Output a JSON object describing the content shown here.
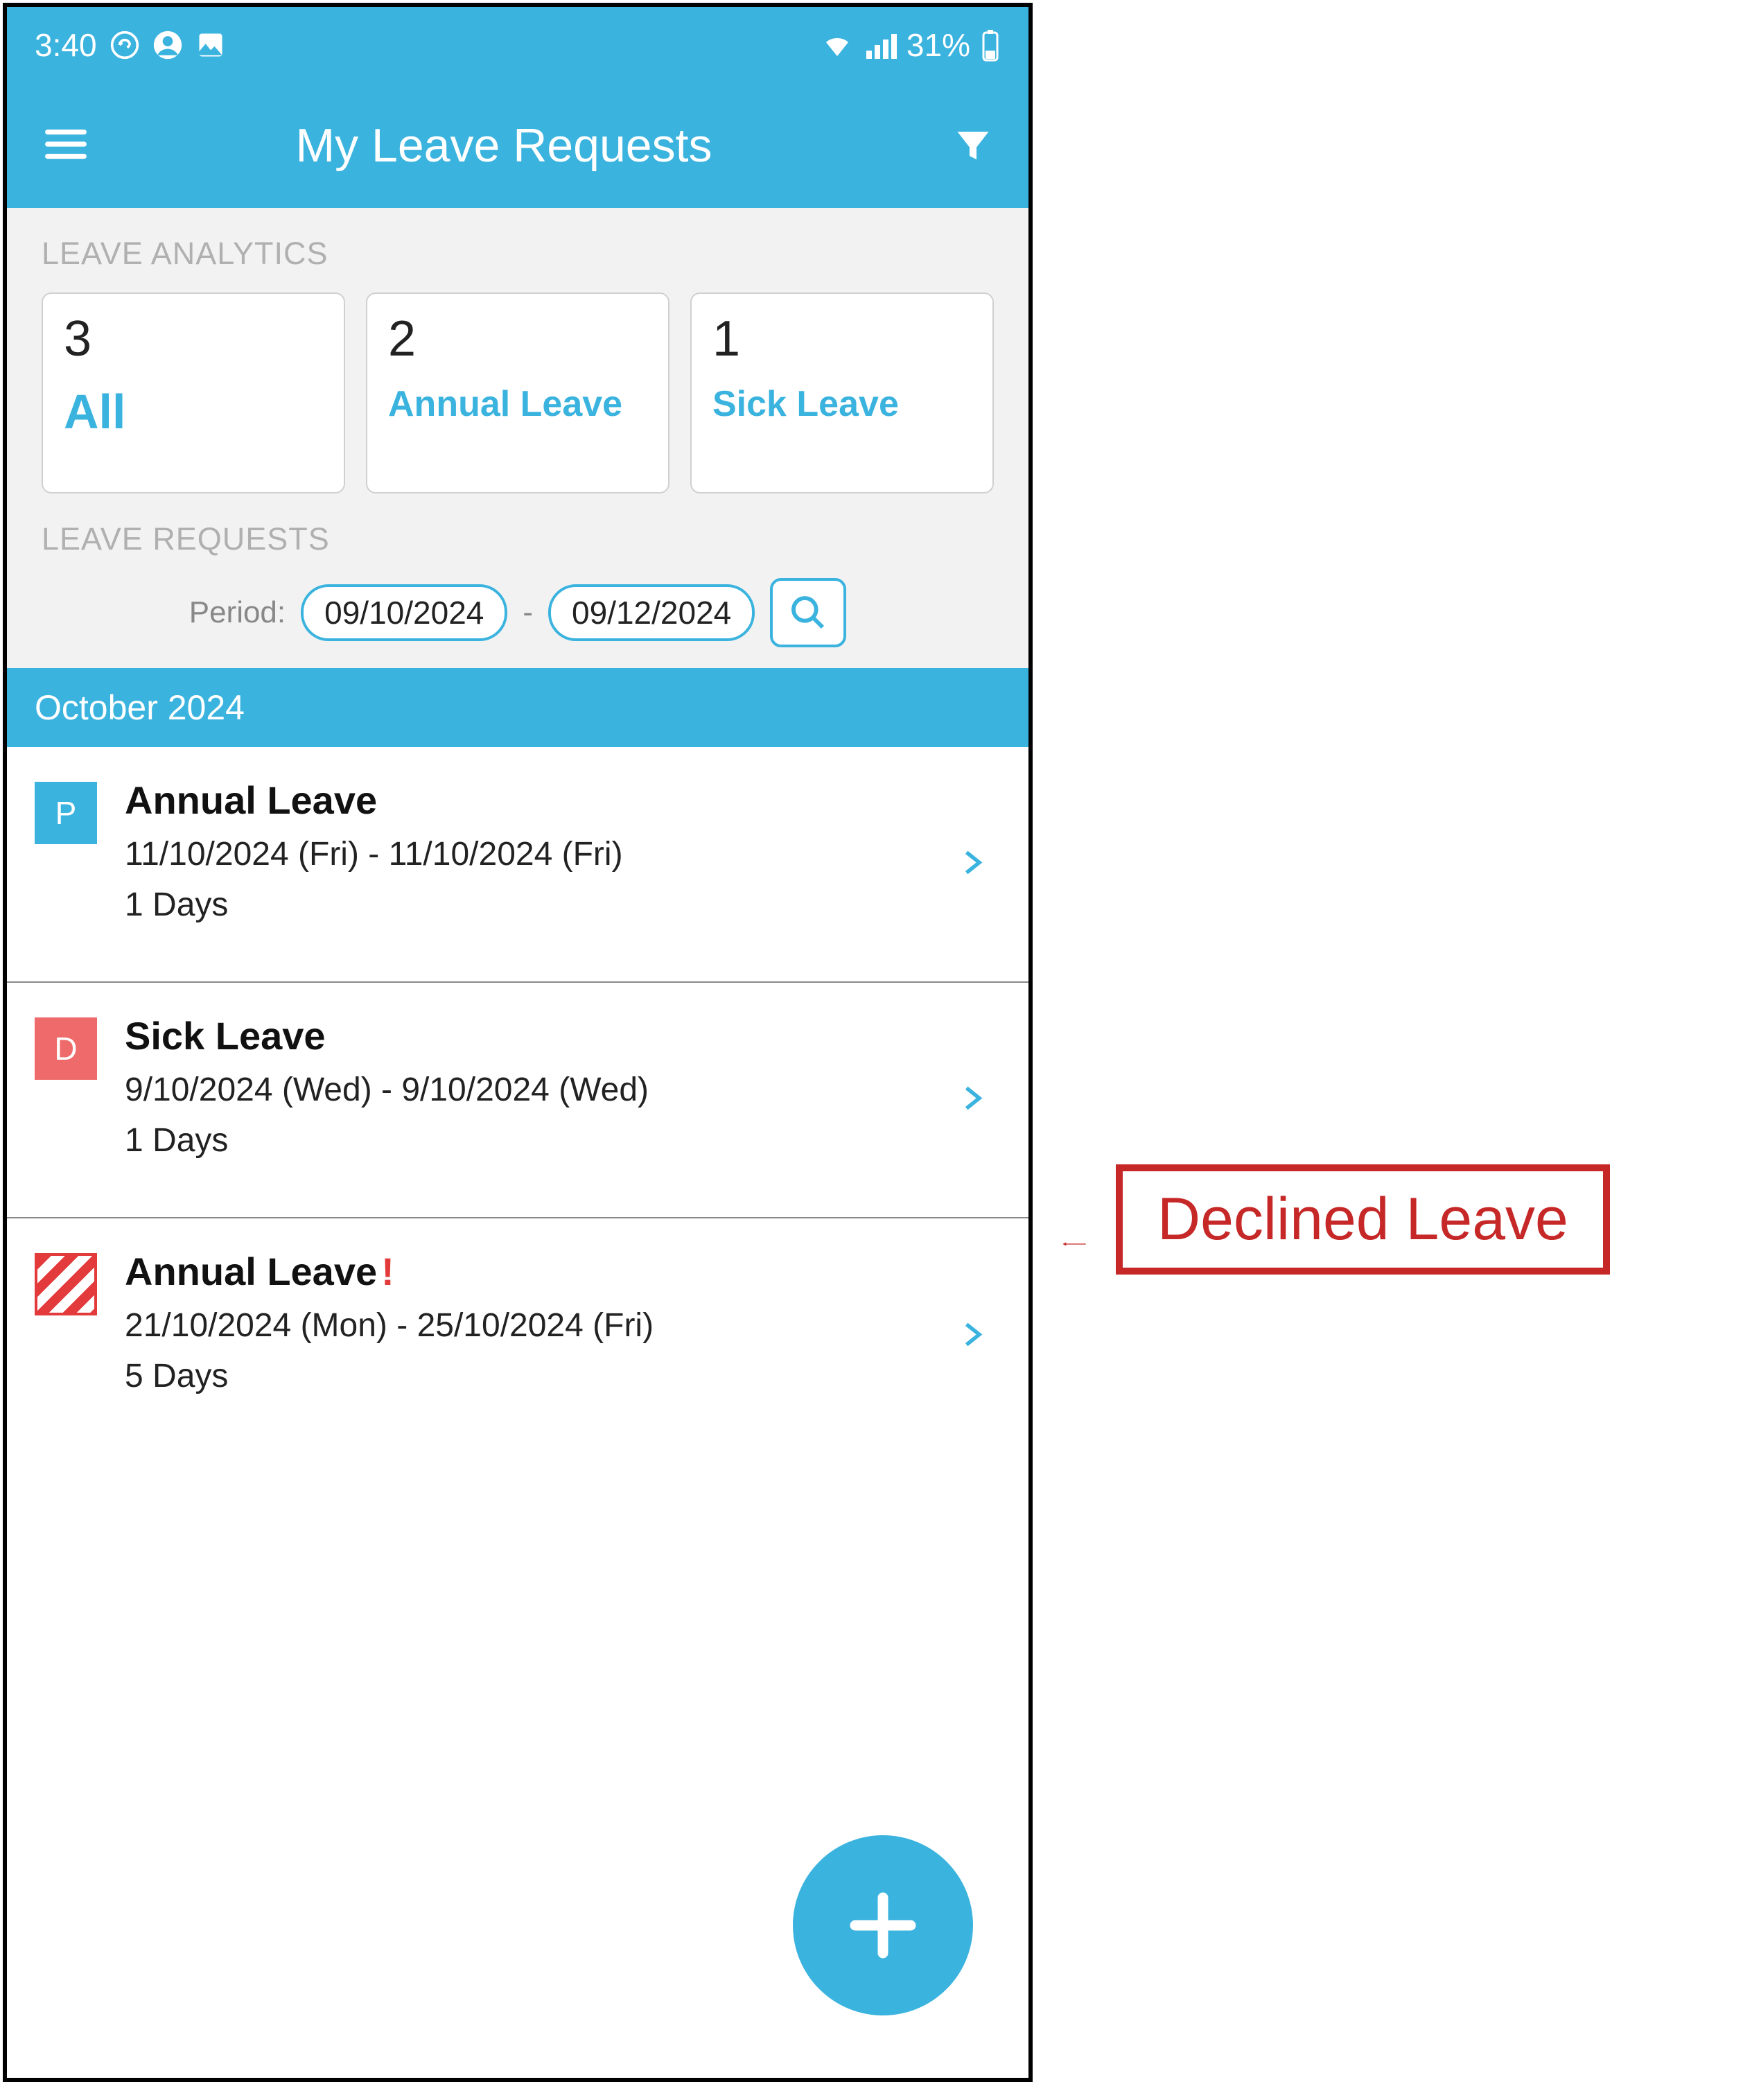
{
  "statusbar": {
    "time": "3:40",
    "battery_text": "31%"
  },
  "appbar": {
    "title": "My Leave Requests"
  },
  "analytics": {
    "section_label": "LEAVE ANALYTICS",
    "cards": [
      {
        "count": "3",
        "label": "All"
      },
      {
        "count": "2",
        "label": "Annual Leave"
      },
      {
        "count": "1",
        "label": "Sick Leave"
      }
    ]
  },
  "requests": {
    "section_label": "LEAVE REQUESTS",
    "period_label": "Period:",
    "period_from": "09/10/2024",
    "period_separator": "-",
    "period_to": "09/12/2024",
    "month_header": "October 2024",
    "items": [
      {
        "badge": "P",
        "badge_type": "P",
        "title": "Annual Leave",
        "warn": "",
        "dates": "11/10/2024 (Fri) - 11/10/2024 (Fri)",
        "days": "1 Days"
      },
      {
        "badge": "D",
        "badge_type": "D",
        "title": "Sick Leave",
        "warn": "",
        "dates": "9/10/2024 (Wed) - 9/10/2024 (Wed)",
        "days": "1 Days"
      },
      {
        "badge": "",
        "badge_type": "striped",
        "title": "Annual Leave",
        "warn": "!",
        "dates": "21/10/2024 (Mon) - 25/10/2024 (Fri)",
        "days": "5 Days"
      }
    ]
  },
  "annotation": {
    "label": "Declined Leave"
  }
}
